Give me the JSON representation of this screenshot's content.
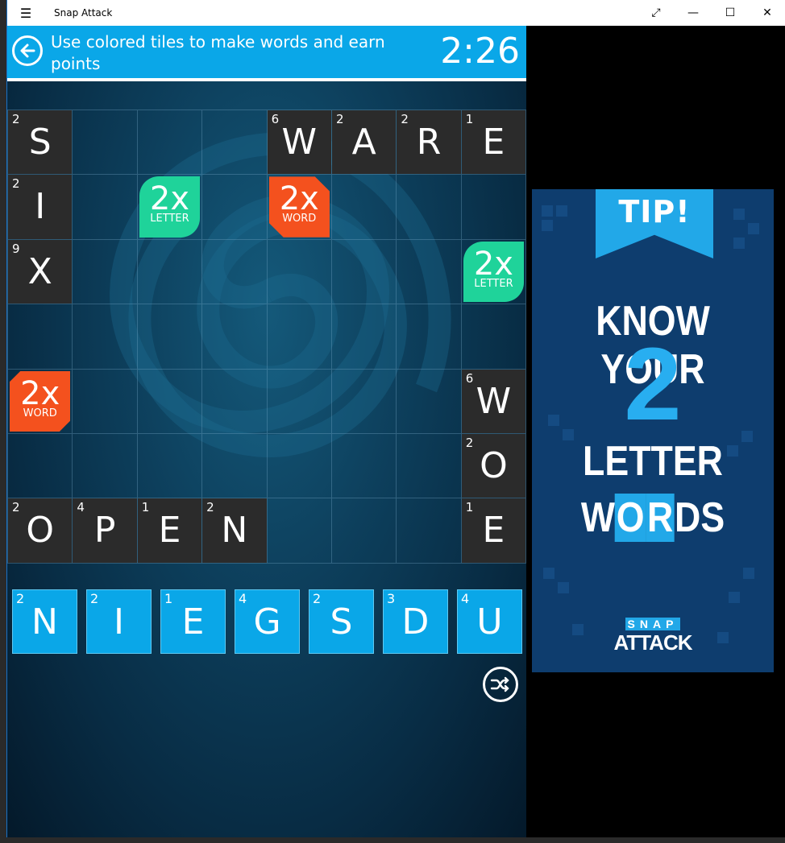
{
  "window": {
    "title": "Snap Attack",
    "menu_icon": "hamburger-icon",
    "controls": [
      "expand-icon",
      "minimize-icon",
      "maximize-icon",
      "close-icon"
    ]
  },
  "header": {
    "instruction": "Use colored tiles to make words and earn points",
    "timer": "2:26",
    "accent_color": "#0aa7e8"
  },
  "board": {
    "tiles": [
      {
        "row": 0,
        "col": 0,
        "letter": "S",
        "points": "2"
      },
      {
        "row": 0,
        "col": 4,
        "letter": "W",
        "points": "6"
      },
      {
        "row": 0,
        "col": 5,
        "letter": "A",
        "points": "2"
      },
      {
        "row": 0,
        "col": 6,
        "letter": "R",
        "points": "2"
      },
      {
        "row": 0,
        "col": 7,
        "letter": "E",
        "points": "1"
      },
      {
        "row": 1,
        "col": 0,
        "letter": "I",
        "points": "2"
      },
      {
        "row": 2,
        "col": 0,
        "letter": "X",
        "points": "9"
      },
      {
        "row": 4,
        "col": 7,
        "letter": "W",
        "points": "6"
      },
      {
        "row": 5,
        "col": 7,
        "letter": "O",
        "points": "2"
      },
      {
        "row": 6,
        "col": 0,
        "letter": "O",
        "points": "2"
      },
      {
        "row": 6,
        "col": 1,
        "letter": "P",
        "points": "4"
      },
      {
        "row": 6,
        "col": 2,
        "letter": "E",
        "points": "1"
      },
      {
        "row": 6,
        "col": 3,
        "letter": "N",
        "points": "2"
      },
      {
        "row": 6,
        "col": 7,
        "letter": "E",
        "points": "1"
      }
    ],
    "bonuses": [
      {
        "row": 1,
        "col": 2,
        "mult": "2x",
        "kind": "LETTER"
      },
      {
        "row": 1,
        "col": 4,
        "mult": "2x",
        "kind": "WORD"
      },
      {
        "row": 2,
        "col": 7,
        "mult": "2x",
        "kind": "LETTER"
      },
      {
        "row": 4,
        "col": 0,
        "mult": "2x",
        "kind": "WORD"
      }
    ],
    "rows": 7,
    "cols": 8,
    "letter_bonus_color": "#1fd39a",
    "word_bonus_color": "#f4511e"
  },
  "rack": [
    {
      "letter": "N",
      "points": "2"
    },
    {
      "letter": "I",
      "points": "2"
    },
    {
      "letter": "E",
      "points": "1"
    },
    {
      "letter": "G",
      "points": "4"
    },
    {
      "letter": "S",
      "points": "2"
    },
    {
      "letter": "D",
      "points": "3"
    },
    {
      "letter": "U",
      "points": "4"
    }
  ],
  "shuffle_icon": "shuffle-icon",
  "ad": {
    "tip": "TIP!",
    "line1": "KNOW YOUR",
    "number": "2",
    "line2": "LETTER",
    "line3_parts": [
      "W",
      "O",
      "R",
      "DS"
    ],
    "logo_top": "SNAP",
    "logo_bottom": "ATTACK"
  }
}
